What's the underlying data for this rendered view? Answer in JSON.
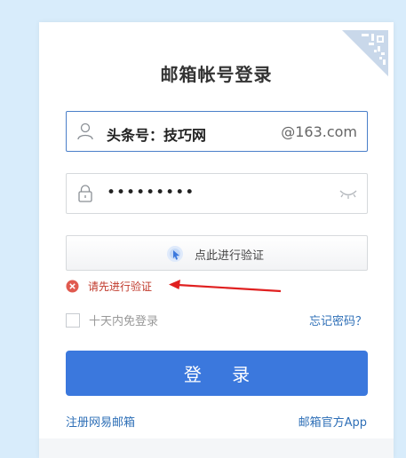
{
  "colors": {
    "background": "#d8ecfb",
    "primary": "#3b78dd",
    "link": "#2e6fb7",
    "error": "#c0392b",
    "focus_border": "#4a7fc9"
  },
  "header": {
    "title": "邮箱帐号登录",
    "qr_icon": "qr-code-icon"
  },
  "account": {
    "icon": "user-icon",
    "value": "头条号：技巧网",
    "suffix": "@163.com"
  },
  "password": {
    "icon": "lock-icon",
    "value": "•••••••••",
    "toggle_icon": "eye-closed-icon"
  },
  "verify": {
    "icon": "cursor-click-icon",
    "label": "点此进行验证"
  },
  "error": {
    "icon": "error-circle-icon",
    "text": "请先进行验证"
  },
  "annotation": {
    "icon": "red-arrow-icon"
  },
  "remember": {
    "label": "十天内免登录",
    "checked": false
  },
  "forgot_password": "忘记密码？",
  "login_button": "登 录",
  "footer_links": {
    "register": "注册网易邮箱",
    "app": "邮箱官方App"
  }
}
